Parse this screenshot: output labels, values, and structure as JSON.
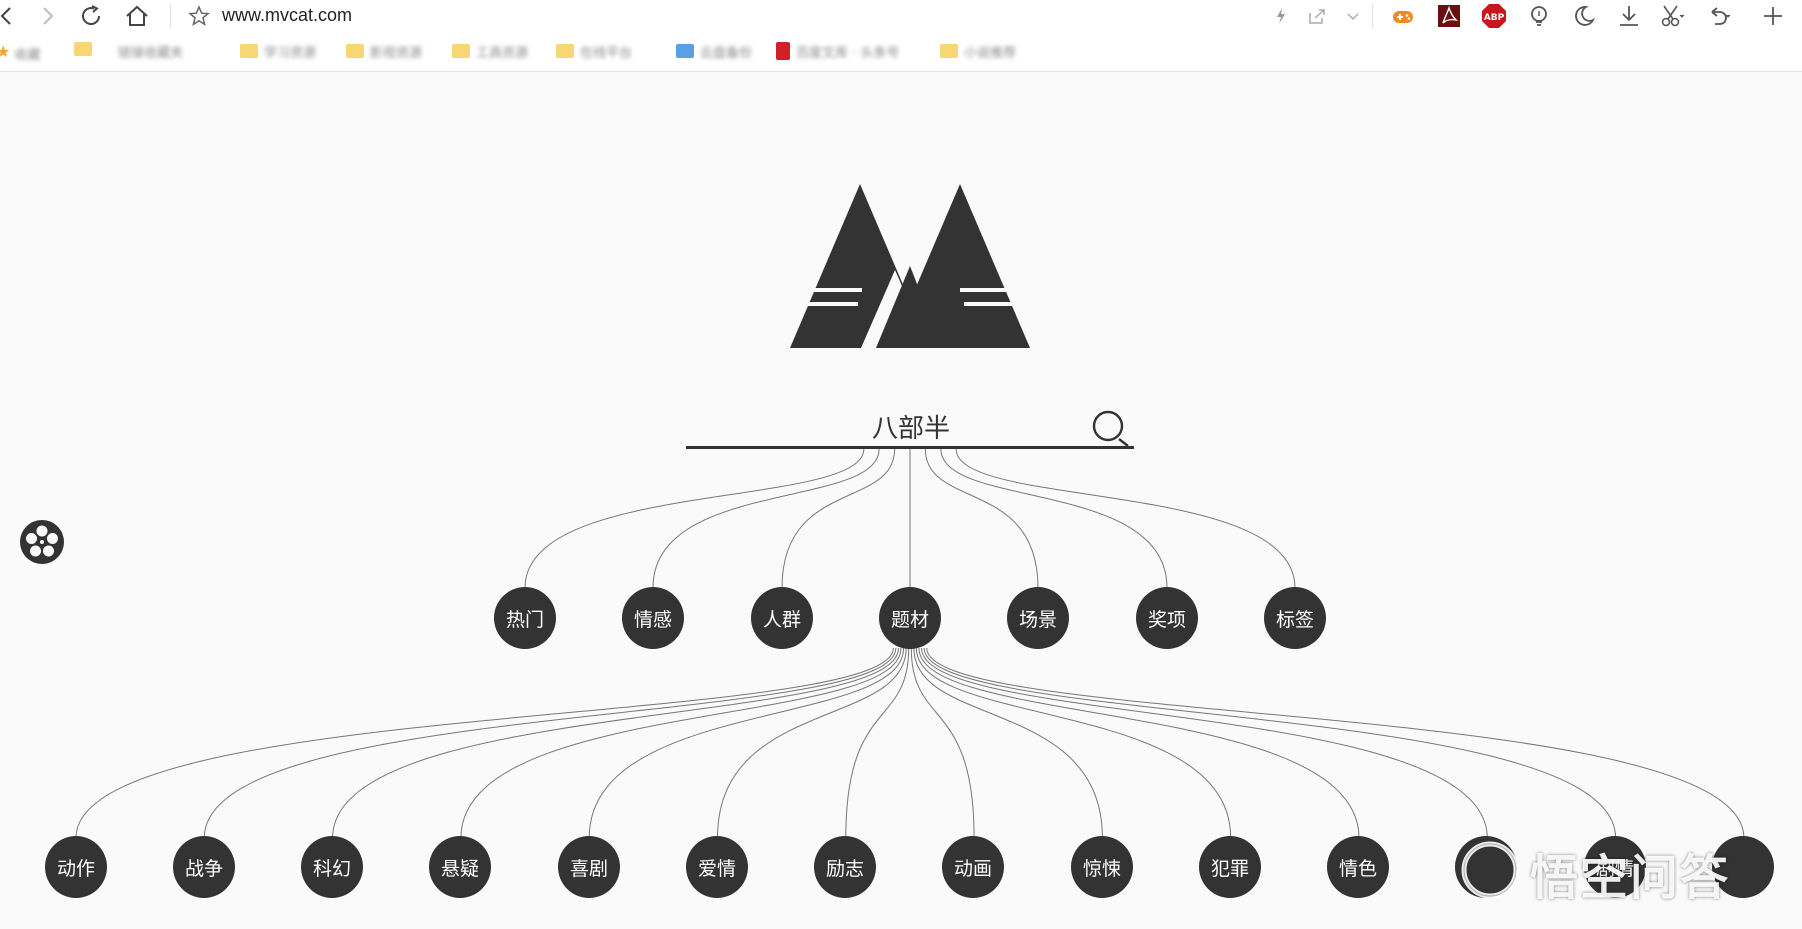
{
  "browser": {
    "url": "www.mvcat.com",
    "bookmarks": [
      {
        "label": "收藏"
      },
      {
        "label": "链接收藏夹"
      },
      {
        "label": "学习资源"
      },
      {
        "label": "影视资源"
      },
      {
        "label": "工具资源"
      },
      {
        "label": "在线平台"
      },
      {
        "label": "云盘备份"
      },
      {
        "label": "百度文库 · 头条号"
      },
      {
        "label": "小说推荐"
      }
    ],
    "toolbar_icons": [
      "bolt-icon",
      "share-icon",
      "chevron-down-icon",
      "gamepad-icon",
      "pdf-icon",
      "adblock-icon",
      "bulb-icon",
      "moon-icon",
      "download-icon",
      "scissors-icon",
      "undo-icon",
      "plus-icon"
    ],
    "adblock_label": "ABP"
  },
  "page": {
    "search_value": "八部半",
    "categories": [
      "热门",
      "情感",
      "人群",
      "题材",
      "场景",
      "奖项",
      "标签"
    ],
    "subcategories": [
      "动作",
      "战争",
      "科幻",
      "悬疑",
      "喜剧",
      "爱情",
      "励志",
      "动画",
      "惊悚",
      "犯罪",
      "情色",
      "",
      "剧情",
      ""
    ],
    "watermark": "悟空问答",
    "colors": {
      "node": "#333333",
      "background": "#fafafa",
      "line": "#777777"
    }
  }
}
